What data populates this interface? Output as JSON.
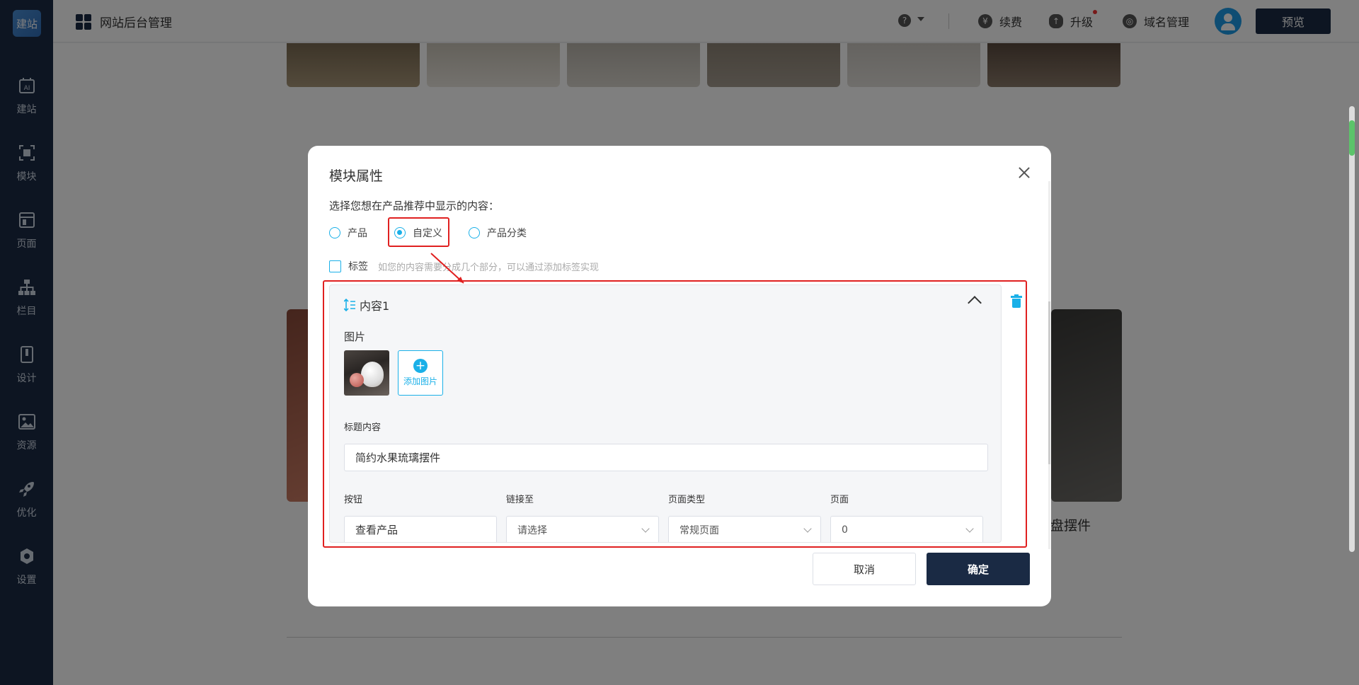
{
  "sidebar": {
    "logo": "建站",
    "items": [
      {
        "label": "建站",
        "icon": "ai-icon"
      },
      {
        "label": "模块",
        "icon": "module-icon"
      },
      {
        "label": "页面",
        "icon": "page-icon"
      },
      {
        "label": "栏目",
        "icon": "sitemap-icon"
      },
      {
        "label": "设计",
        "icon": "design-icon"
      },
      {
        "label": "资源",
        "icon": "image-icon"
      },
      {
        "label": "优化",
        "icon": "rocket-icon"
      },
      {
        "label": "设置",
        "icon": "gear-icon"
      }
    ]
  },
  "topbar": {
    "title": "网站后台管理",
    "renew": "续费",
    "upgrade": "升级",
    "domain": "域名管理",
    "preview": "预览",
    "help": "?"
  },
  "background": {
    "caption": "盘摆件"
  },
  "modal": {
    "title": "模块属性",
    "prompt": "选择您想在产品推荐中显示的内容：",
    "radio_options": [
      {
        "label": "产品",
        "selected": false
      },
      {
        "label": "自定义",
        "selected": true
      },
      {
        "label": "产品分类",
        "selected": false
      }
    ],
    "tag_checkbox_label": "标签",
    "tag_hint": "如您的内容需要分成几个部分，可以通过添加标签实现",
    "content_panel": {
      "header": "内容1",
      "image_label": "图片",
      "add_image_label": "添加图片",
      "title_label": "标题内容",
      "title_value": "简约水果琉璃摆件",
      "button_label": "按钮",
      "button_value": "查看产品",
      "link_label": "链接至",
      "link_value": "请选择",
      "page_type_label": "页面类型",
      "page_type_value": "常规页面",
      "page_label": "页面",
      "page_value": "0"
    },
    "cancel": "取消",
    "confirm": "确定"
  },
  "colors": {
    "accent": "#1ab0e8",
    "sidebar": "#1a2a44",
    "highlight": "#e02020"
  }
}
